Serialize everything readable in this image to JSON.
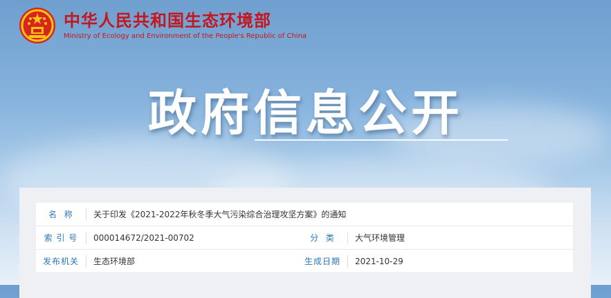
{
  "header": {
    "org_cn": "中华人民共和国生态环境部",
    "org_en": "Ministry of Ecology and Environment of the People's Republic of China"
  },
  "banner": {
    "title": "政府信息公开"
  },
  "info": {
    "name_label": "名  称",
    "name_value": "关于印发《2021-2022年秋冬季大气污染综合治理攻坚方案》的通知",
    "index_label": "索 引 号",
    "index_value": "000014672/2021-00702",
    "category_label": "分  类",
    "category_value": "大气环境管理",
    "issuer_label": "发布机关",
    "issuer_value": "生态环境部",
    "date_label": "生成日期",
    "date_value": "2021-10-29"
  },
  "colors": {
    "brand_red": "#c4161c",
    "label_blue": "#2b77b9"
  }
}
